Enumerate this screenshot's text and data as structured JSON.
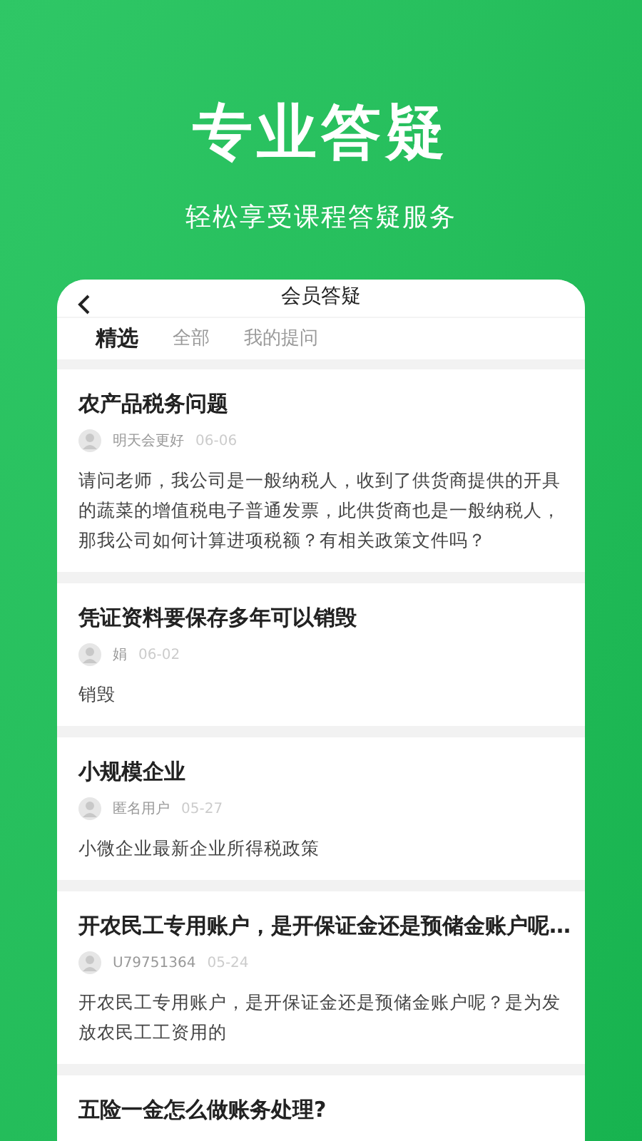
{
  "headline": "专业答疑",
  "subheadline": "轻松享受课程答疑服务",
  "screen": {
    "title": "会员答疑",
    "tabs": [
      {
        "label": "精选",
        "selected": true
      },
      {
        "label": "全部",
        "selected": false
      },
      {
        "label": "我的提问",
        "selected": false
      }
    ],
    "questions": [
      {
        "title": "农产品税务问题",
        "user": "明天会更好",
        "date": "06-06",
        "body": "请问老师，我公司是一般纳税人，收到了供货商提供的开具的蔬菜的增值税电子普通发票，此供货商也是一般纳税人，那我公司如何计算进项税额？有相关政策文件吗？"
      },
      {
        "title": "凭证资料要保存多年可以销毁",
        "user": "娟",
        "date": "06-02",
        "body": "销毁"
      },
      {
        "title": "小规模企业",
        "user": "匿名用户",
        "date": "05-27",
        "body": "小微企业最新企业所得税政策"
      },
      {
        "title": "开农民工专用账户，是开保证金还是预储金账户呢…",
        "user": "U79751364",
        "date": "05-24",
        "body": "开农民工专用账户，是开保证金还是预储金账户呢？是为发放农民工工资用的"
      },
      {
        "title": "五险一金怎么做账务处理?"
      }
    ]
  }
}
